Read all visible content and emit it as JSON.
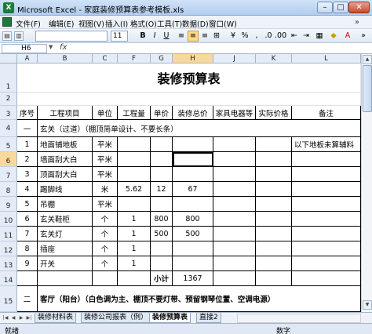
{
  "window": {
    "title": "Microsoft Excel - 家庭装修预算表参考模板.xls",
    "app_badge": "X"
  },
  "menu": [
    "文件(F)",
    "编辑(E)",
    "视图(V)",
    "插入(I)",
    "格式(O)",
    "工具(T)",
    "数据(D)",
    "窗口(W)"
  ],
  "menu_overflow": "»",
  "toolbar": {
    "font_name": "",
    "font_size": "11",
    "bold": "B",
    "italic": "I",
    "underline": "U"
  },
  "formula": {
    "name_box": "H6",
    "fx": "fx",
    "content": ""
  },
  "columns": [
    "A",
    "B",
    "C",
    "F",
    "G",
    "H",
    "J",
    "K",
    "L"
  ],
  "rows": [
    "1",
    "2",
    "3",
    "4",
    "5",
    "6",
    "7",
    "8",
    "9",
    "10",
    "11",
    "12",
    "13",
    "14",
    "15"
  ],
  "sheet": {
    "title": "装修预算表",
    "headers": [
      "序号",
      "工程项目",
      "单位",
      "工程量",
      "单价",
      "装修总价",
      "家具电器等",
      "实际价格",
      "备注"
    ],
    "section1": {
      "num": "一",
      "label": "玄关（过道）（棚顶简单设计、不要长条）"
    },
    "items": [
      {
        "no": "1",
        "name": "地面铺地板",
        "unit": "平米",
        "qty": "",
        "price": "",
        "total": "",
        "furniture": "",
        "actual": "",
        "note": "以下地板未算辅料"
      },
      {
        "no": "2",
        "name": "墙面刮大白",
        "unit": "平米",
        "qty": "",
        "price": "",
        "total": "",
        "furniture": "",
        "actual": "",
        "note": ""
      },
      {
        "no": "3",
        "name": "顶面刮大白",
        "unit": "平米",
        "qty": "",
        "price": "",
        "total": "",
        "furniture": "",
        "actual": "",
        "note": ""
      },
      {
        "no": "4",
        "name": "踢脚线",
        "unit": "米",
        "qty": "5.62",
        "price": "12",
        "total": "67",
        "furniture": "",
        "actual": "",
        "note": ""
      },
      {
        "no": "5",
        "name": "吊棚",
        "unit": "平米",
        "qty": "",
        "price": "",
        "total": "",
        "furniture": "",
        "actual": "",
        "note": ""
      },
      {
        "no": "6",
        "name": "玄关鞋柜",
        "unit": "个",
        "qty": "1",
        "price": "800",
        "total": "800",
        "furniture": "",
        "actual": "",
        "note": ""
      },
      {
        "no": "7",
        "name": "玄关灯",
        "unit": "个",
        "qty": "1",
        "price": "500",
        "total": "500",
        "furniture": "",
        "actual": "",
        "note": ""
      },
      {
        "no": "8",
        "name": "插座",
        "unit": "个",
        "qty": "1",
        "price": "",
        "total": "",
        "furniture": "",
        "actual": "",
        "note": ""
      },
      {
        "no": "9",
        "name": "开关",
        "unit": "个",
        "qty": "1",
        "price": "",
        "total": "",
        "furniture": "",
        "actual": "",
        "note": ""
      }
    ],
    "subtotal": {
      "label": "小计",
      "value": "1367"
    },
    "section2": {
      "num": "二",
      "label": "客厅（阳台）（白色调为主、棚顶不要灯带、预留钢琴位置、空调电源）"
    }
  },
  "tabs": [
    "装修材料表",
    "装修公司报表（例）",
    "装修预算表",
    "直接2"
  ],
  "active_tab": 2,
  "status": {
    "left": "就绪",
    "right": "数字"
  },
  "colors": {
    "selection": "#f9d99b",
    "header_bg": "#e4ecf7",
    "title_bar": "#b3cdee"
  }
}
